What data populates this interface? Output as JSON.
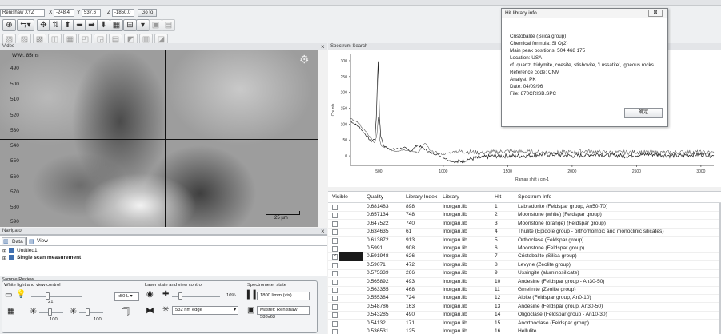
{
  "toolbar": {
    "device": "Renishaw XYZ",
    "x_label": "X",
    "x_value": "-248.4",
    "y_label": "Y",
    "y_value": "537.6",
    "z_label": "Z",
    "z_value": "-1850.0",
    "goto_label": "Go to"
  },
  "video_panel": {
    "title": "Video",
    "overlay": "WWr. 85ms",
    "scale_bar": "25 µm",
    "y_ticks": [
      "490",
      "500",
      "510",
      "520",
      "530",
      "540",
      "550",
      "560",
      "570",
      "580",
      "590"
    ]
  },
  "spectrum_panel": {
    "title": "Spectrum Search",
    "xlabel": "Raman shift / cm-1",
    "ylabel": "Counts"
  },
  "chart_data": {
    "type": "line",
    "xlabel": "Raman shift / cm-1",
    "ylabel": "Counts",
    "x_ticks": [
      "500",
      "1000",
      "1500",
      "2000",
      "2500",
      "3000"
    ],
    "y_ticks": [
      "300",
      "250",
      "200",
      "150",
      "100",
      "50",
      "0"
    ],
    "xlim": [
      280,
      3100
    ],
    "ylim": [
      -30,
      320
    ],
    "series": [
      {
        "color": "#222222",
        "x": [
          280,
          350,
          400,
          440,
          470,
          480,
          490,
          495,
          500,
          505,
          515,
          540,
          600,
          700,
          750,
          800,
          860,
          900,
          950,
          1000,
          1050,
          1100,
          1200,
          1400,
          1600,
          1800,
          2000,
          2200,
          2400,
          2600,
          2800,
          3000,
          3100
        ],
        "y": [
          110,
          90,
          65,
          45,
          55,
          120,
          250,
          300,
          210,
          120,
          60,
          30,
          20,
          25,
          15,
          35,
          20,
          10,
          5,
          -5,
          -15,
          -20,
          -10,
          0,
          0,
          5,
          0,
          5,
          0,
          5,
          0,
          5,
          0
        ]
      },
      {
        "color": "#555555",
        "x": [
          280,
          350,
          400,
          440,
          470,
          485,
          495,
          505,
          520,
          560,
          620,
          700,
          800,
          860,
          900,
          1000,
          1100,
          1300,
          1500,
          1700,
          1900,
          2100,
          2300,
          2500,
          2700,
          2900,
          3100
        ],
        "y": [
          120,
          100,
          75,
          55,
          40,
          70,
          120,
          55,
          30,
          25,
          15,
          20,
          10,
          40,
          15,
          5,
          15,
          10,
          15,
          12,
          10,
          15,
          10,
          12,
          10,
          12,
          10
        ]
      }
    ]
  },
  "hit_dialog": {
    "title": "Hit library info",
    "close": "⊠",
    "lines": [
      "Cristobalite (Silica group)",
      "Chemical formula: Si O(2)",
      "Main peak positions: 504 468 175",
      "Location: USA",
      "cf. quartz, tridymite, coesite, stishovite, 'Lussatite', igneous rocks",
      "Reference code: CNM",
      "Analyst: PK",
      "Date: 04/09/96",
      "File: 870CRISB.SPC"
    ],
    "ok_label": "确定"
  },
  "results_table": {
    "headers": [
      "Visible",
      "Quality",
      "Library Index",
      "Library",
      "Hit",
      "Spectrum Info"
    ],
    "rows": [
      {
        "quality": "0.681483",
        "index": "898",
        "library": "Inorgan.lib",
        "hit": "1",
        "info": "Labradorite (Feldspar group, An50-70)"
      },
      {
        "quality": "0.657134",
        "index": "748",
        "library": "Inorgan.lib",
        "hit": "2",
        "info": "Moonstone (white) (Feldspar group)"
      },
      {
        "quality": "0.647522",
        "index": "740",
        "library": "Inorgan.lib",
        "hit": "3",
        "info": "Moonstone (orange) (Feldspar group)"
      },
      {
        "quality": "0.634635",
        "index": "61",
        "library": "Inorgan.lib",
        "hit": "4",
        "info": "Thulite (Epidote group - orthorhombic and monoclinic silicates)"
      },
      {
        "quality": "0.613872",
        "index": "913",
        "library": "Inorgan.lib",
        "hit": "5",
        "info": "Orthoclase (Feldspar group)"
      },
      {
        "quality": "0.5991",
        "index": "908",
        "library": "Inorgan.lib",
        "hit": "6",
        "info": "Moonstone (Feldspar group)"
      },
      {
        "quality": "0.591948",
        "index": "626",
        "library": "Inorgan.lib",
        "hit": "7",
        "info": "Cristobalite (Silica group)",
        "checked": true,
        "selected": true
      },
      {
        "quality": "0.59071",
        "index": "472",
        "library": "Inorgan.lib",
        "hit": "8",
        "info": "Levyne (Zeolite group)"
      },
      {
        "quality": "0.575339",
        "index": "266",
        "library": "Inorgan.lib",
        "hit": "9",
        "info": "Ussingite (aluminosilicate)"
      },
      {
        "quality": "0.565892",
        "index": "493",
        "library": "Inorgan.lib",
        "hit": "10",
        "info": "Andesine (Feldspar group - An30-50)"
      },
      {
        "quality": "0.563355",
        "index": "468",
        "library": "Inorgan.lib",
        "hit": "11",
        "info": "Gmelinite (Zeolite group)"
      },
      {
        "quality": "0.555384",
        "index": "724",
        "library": "Inorgan.lib",
        "hit": "12",
        "info": "Albite (Feldspar group, An0-10)"
      },
      {
        "quality": "0.548786",
        "index": "163",
        "library": "Inorgan.lib",
        "hit": "13",
        "info": "Andesine (Feldspar group, An30-50)"
      },
      {
        "quality": "0.543285",
        "index": "490",
        "library": "Inorgan.lib",
        "hit": "14",
        "info": "Oligoclase (Feldspar group - An10-30)"
      },
      {
        "quality": "0.54132",
        "index": "171",
        "library": "Inorgan.lib",
        "hit": "15",
        "info": "Anorthoclase (Feldspar group)"
      },
      {
        "quality": "0.536531",
        "index": "125",
        "library": "Inorgan.lib",
        "hit": "16",
        "info": "Hellulite"
      }
    ]
  },
  "navigator": {
    "title": "Navigator",
    "tabs": [
      "Data",
      "View"
    ],
    "items": [
      "Untitled1",
      "Single scan measurement"
    ]
  },
  "sample_review": {
    "title": "Sample Review",
    "white_light_label": "White light and view control",
    "slider_value": "21",
    "slider_min": "100",
    "slider_max": "100",
    "zoom_value": "x50 L",
    "laser_label": "Laser state and view control",
    "laser_power": "10%",
    "laser_edge": "532 nm edge",
    "spectrometer_label": "Spectrometer state",
    "grating": "1800 l/mm (vis)",
    "master": "Master: Renishaw 588v63"
  }
}
